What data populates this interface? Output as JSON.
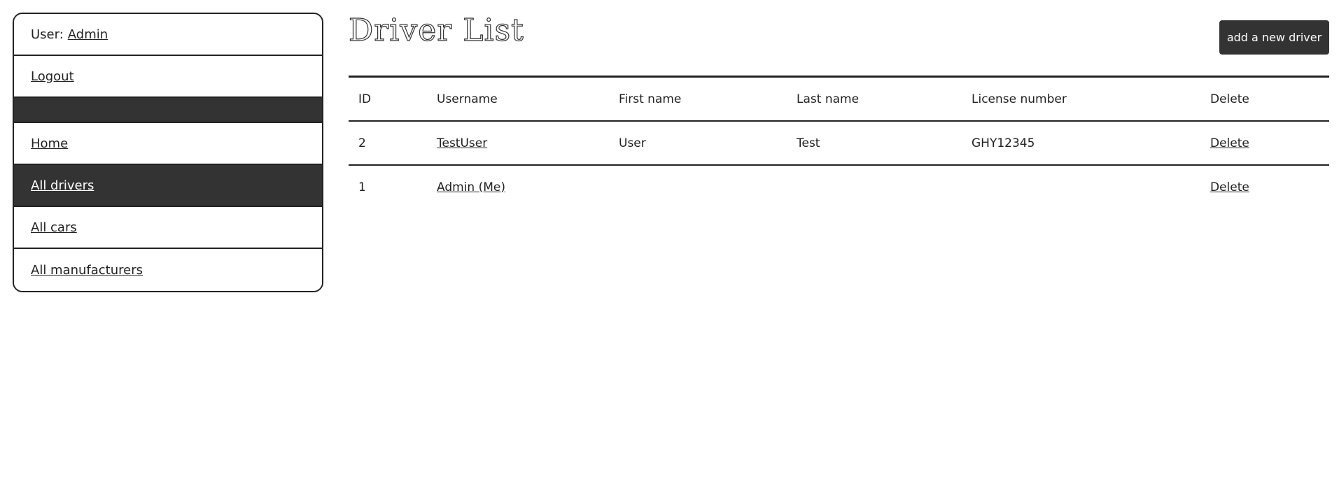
{
  "sidebar": {
    "user_prefix": "User:",
    "user_name": "Admin",
    "logout": "Logout",
    "items": [
      {
        "label": "Home"
      },
      {
        "label": "All drivers"
      },
      {
        "label": "All cars"
      },
      {
        "label": "All manufacturers"
      }
    ]
  },
  "main": {
    "title": "Driver List",
    "add_button": "add a new driver",
    "table": {
      "headers": [
        "ID",
        "Username",
        "First name",
        "Last name",
        "License number",
        "Delete"
      ],
      "rows": [
        {
          "id": "2",
          "username": "TestUser",
          "first_name": "User",
          "last_name": "Test",
          "license": "GHY12345",
          "delete": "Delete"
        },
        {
          "id": "1",
          "username": "Admin (Me)",
          "first_name": "",
          "last_name": "",
          "license": "",
          "delete": "Delete"
        }
      ]
    }
  },
  "colors": {
    "dark": "#333333",
    "text": "#222222",
    "background": "#ffffff"
  }
}
